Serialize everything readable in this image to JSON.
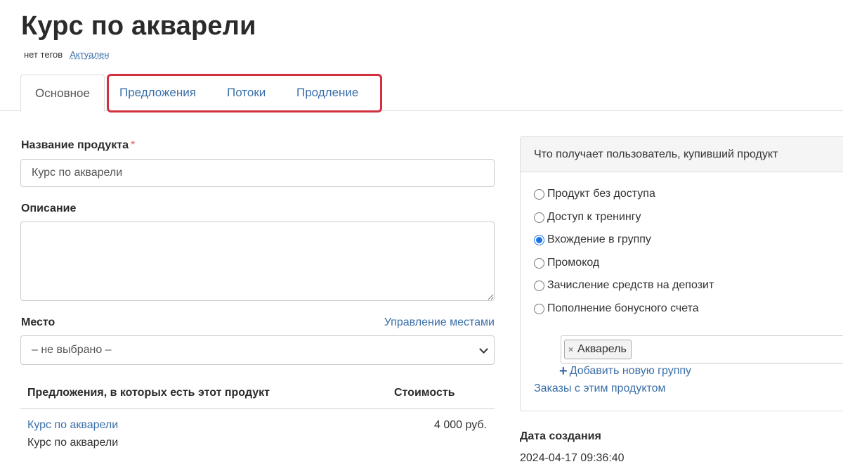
{
  "header": {
    "title": "Курс по акварели",
    "tags_text": "нет тегов",
    "status_link": "Актуален"
  },
  "tabs": [
    {
      "label": "Основное",
      "active": true
    },
    {
      "label": "Предложения",
      "active": false
    },
    {
      "label": "Потоки",
      "active": false
    },
    {
      "label": "Продление",
      "active": false
    }
  ],
  "form": {
    "name_label": "Название продукта",
    "required_mark": "*",
    "name_value": "Курс по акварели",
    "description_label": "Описание",
    "description_value": "",
    "place_label": "Место",
    "manage_places_link": "Управление местами",
    "place_selected": "– не выбрано –"
  },
  "offers": {
    "col_title": "Предложения, в которых есть этот продукт",
    "col_price": "Стоимость",
    "rows": [
      {
        "link": "Курс по акварели",
        "subtitle": "Курс по акварели",
        "price": "4 000 руб."
      }
    ]
  },
  "access_panel": {
    "heading": "Что получает пользователь, купивший продукт",
    "options": [
      {
        "label": "Продукт без доступа",
        "checked": false
      },
      {
        "label": "Доступ к тренингу",
        "checked": false
      },
      {
        "label": "Вхождение в группу",
        "checked": true
      },
      {
        "label": "Промокод",
        "checked": false
      },
      {
        "label": "Зачисление средств на депозит",
        "checked": false
      },
      {
        "label": "Пополнение бонусного счета",
        "checked": false
      }
    ],
    "group_chip": "Акварель",
    "chip_remove": "×",
    "add_group_plus": "+",
    "add_group_link": "Добавить новую группу",
    "orders_link": "Заказы с этим продуктом"
  },
  "meta": {
    "created_label": "Дата создания",
    "created_value": "2024-04-17 09:36:40"
  },
  "colors": {
    "link": "#3a6fa8",
    "highlight": "#d32f3f",
    "radio_checked": "#1a73e8"
  }
}
